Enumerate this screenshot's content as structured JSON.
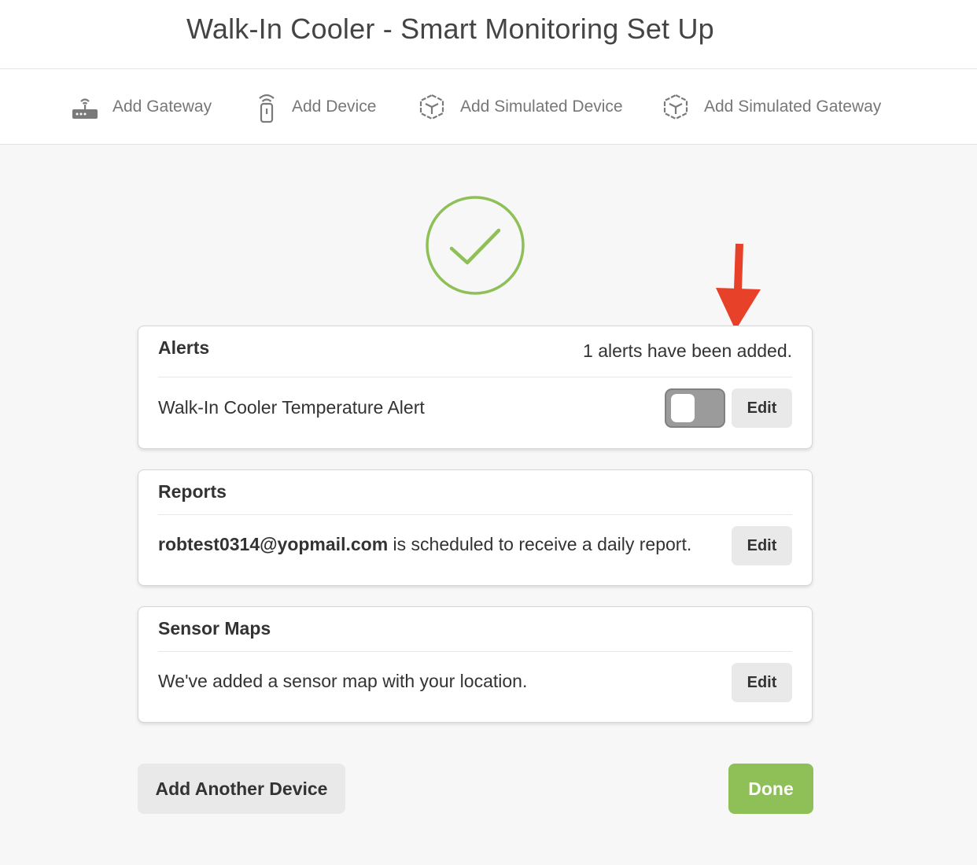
{
  "page": {
    "title": "Walk-In Cooler - Smart Monitoring Set Up"
  },
  "toolbar": {
    "items": [
      {
        "label": "Add Gateway",
        "icon": "gateway-router-icon"
      },
      {
        "label": "Add Device",
        "icon": "sensor-device-icon"
      },
      {
        "label": "Add Simulated Device",
        "icon": "cube-icon"
      },
      {
        "label": "Add Simulated Gateway",
        "icon": "cube-icon"
      }
    ]
  },
  "success": {
    "icon": "checkmark-circle-icon",
    "color": "#8fbf57"
  },
  "alerts": {
    "title": "Alerts",
    "note": "1 alerts have been added.",
    "item_label": "Walk-In Cooler Temperature Alert",
    "toggle_on": false,
    "edit_label": "Edit"
  },
  "reports": {
    "title": "Reports",
    "email": "robtest0314@yopmail.com",
    "text": " is scheduled to receive a daily report.",
    "edit_label": "Edit"
  },
  "sensor_maps": {
    "title": "Sensor Maps",
    "text": "We've added a sensor map with your location.",
    "edit_label": "Edit"
  },
  "actions": {
    "add_another_label": "Add Another Device",
    "done_label": "Done"
  },
  "annotation": {
    "arrow_color": "#e8412a"
  }
}
